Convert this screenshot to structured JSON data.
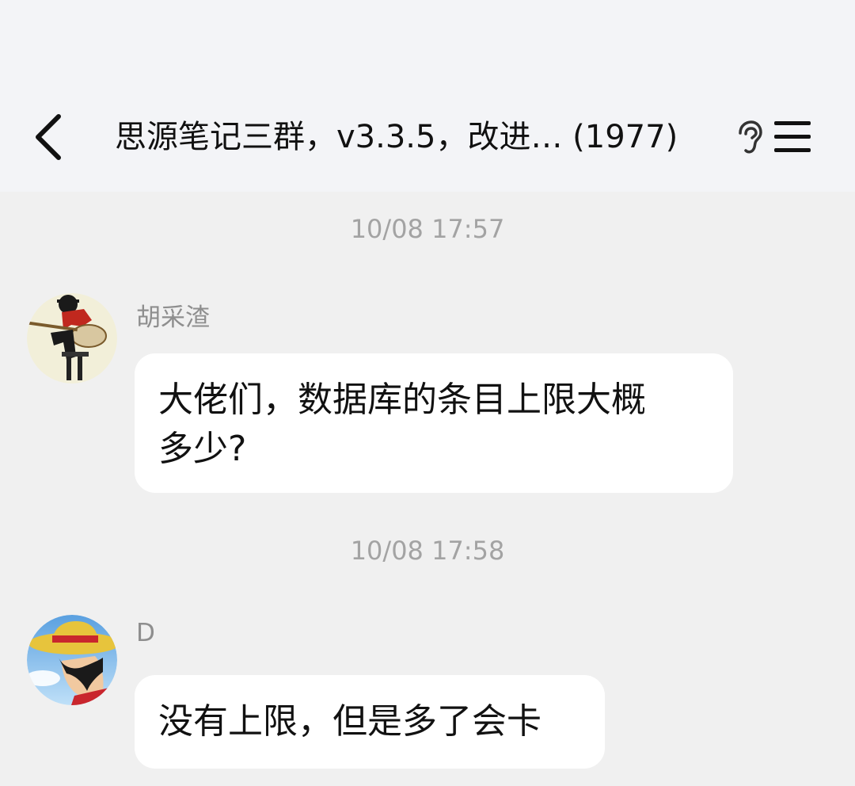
{
  "header": {
    "title": "思源笔记三群，v3.3.5，改进… (1977)",
    "back_icon": "chevron-left-icon",
    "ear_icon": "ear-icon",
    "menu_icon": "hamburger-menu-icon"
  },
  "messages": [
    {
      "timestamp": "10/08 17:57",
      "sender": "胡采渣",
      "text_line1": "大佬们，数据库的条目上限大概",
      "text_line2": "多少?"
    },
    {
      "timestamp": "10/08 17:58",
      "sender": "D",
      "text_line1": "没有上限，但是多了会卡"
    }
  ],
  "colors": {
    "header_bg": "#f3f4f7",
    "chat_bg": "#f0f0f0",
    "bubble_bg": "#ffffff",
    "timestamp": "#a3a3a3",
    "sender": "#8e8e8e"
  }
}
